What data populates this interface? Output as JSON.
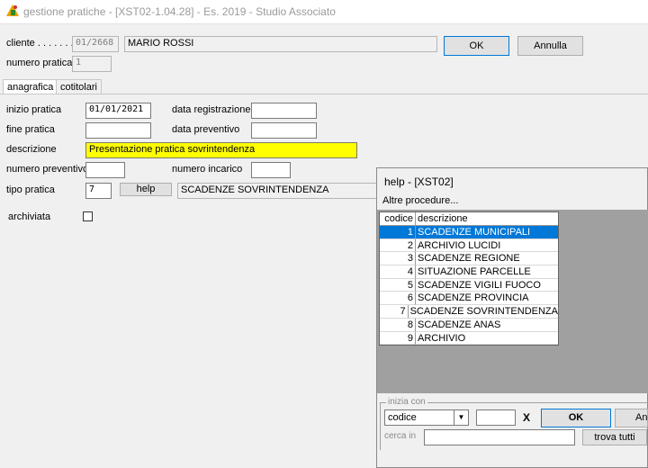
{
  "window": {
    "title": "gestione pratiche - [XST02-1.04.28] - Es. 2019 - Studio Associato"
  },
  "client": {
    "label": "cliente . . . . . . . . .",
    "code": "01/2668",
    "name": "MARIO ROSSI",
    "practice_number_label": "numero pratica",
    "practice_number": "1"
  },
  "buttons": {
    "ok": "OK",
    "annulla": "Annulla"
  },
  "tabs": [
    {
      "label": "anagrafica",
      "active": true
    },
    {
      "label": "cotitolari",
      "active": false
    }
  ],
  "form": {
    "inizio_pratica_label": "inizio pratica",
    "inizio_pratica": "01/01/2021",
    "data_registrazione_label": "data registrazione",
    "data_registrazione": "",
    "fine_pratica_label": "fine pratica",
    "fine_pratica": "",
    "data_preventivo_label": "data preventivo",
    "data_preventivo": "",
    "descrizione_label": "descrizione",
    "descrizione": "Presentazione pratica sovrintendenza",
    "numero_preventivo_label": "numero preventivo",
    "numero_preventivo": "",
    "numero_incarico_label": "numero incarico",
    "numero_incarico": "",
    "tipo_pratica_label": "tipo pratica",
    "tipo_pratica": "7",
    "help_button": "help",
    "tipo_pratica_desc": "SCADENZE SOVRINTENDENZA",
    "archiviata_label": "archiviata",
    "archiviata": false
  },
  "help_dialog": {
    "title": "help - [XST02]",
    "subtitle": "Altre procedure...",
    "columns": [
      "codice",
      "descrizione"
    ],
    "rows": [
      {
        "codice": "1",
        "descrizione": "SCADENZE MUNICIPALI"
      },
      {
        "codice": "2",
        "descrizione": "ARCHIVIO LUCIDI"
      },
      {
        "codice": "3",
        "descrizione": "SCADENZE REGIONE"
      },
      {
        "codice": "4",
        "descrizione": "SITUAZIONE PARCELLE"
      },
      {
        "codice": "5",
        "descrizione": "SCADENZE VIGILI FUOCO"
      },
      {
        "codice": "6",
        "descrizione": "SCADENZE PROVINCIA"
      },
      {
        "codice": "7",
        "descrizione": "SCADENZE SOVRINTENDENZA"
      },
      {
        "codice": "8",
        "descrizione": "SCADENZE ANAS"
      },
      {
        "codice": "9",
        "descrizione": "ARCHIVIO"
      }
    ],
    "selected_row": 1,
    "group_label": "inizia con",
    "search_field_select": "codice",
    "search_value": "",
    "clear_button": "X",
    "ok_button": "OK",
    "cancel_button_partial": "Ann",
    "cerca_in_label": "cerca in",
    "cerca_in_value": "",
    "trova_tutti_button": "trova tutti"
  },
  "colors": {
    "selection": "#0078d7",
    "highlight_field": "#ffff00",
    "dialog_area": "#a0a0a0"
  }
}
